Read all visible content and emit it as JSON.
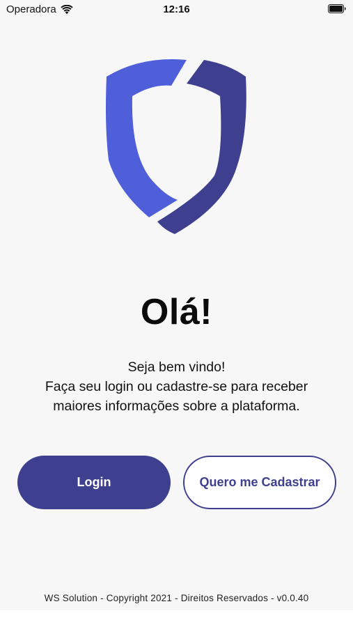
{
  "status_bar": {
    "carrier": "Operadora",
    "time": "12:16",
    "wifi_icon": "wifi-icon",
    "battery_icon": "battery-icon"
  },
  "logo": {
    "icon": "shield-logo-icon",
    "colors": {
      "left": "#4f5fd9",
      "right": "#3e3f8f"
    }
  },
  "welcome": {
    "title": "Olá!",
    "lines": [
      "Seja bem vindo!",
      "Faça seu login ou cadastre-se para receber",
      "maiores informações sobre a plataforma."
    ]
  },
  "actions": {
    "login_label": "Login",
    "register_label": "Quero me Cadastrar",
    "accent": "#3e3f8f"
  },
  "footer": {
    "text": "WS Solution - Copyright 2021 - Direitos Reservados - v0.0.40"
  }
}
